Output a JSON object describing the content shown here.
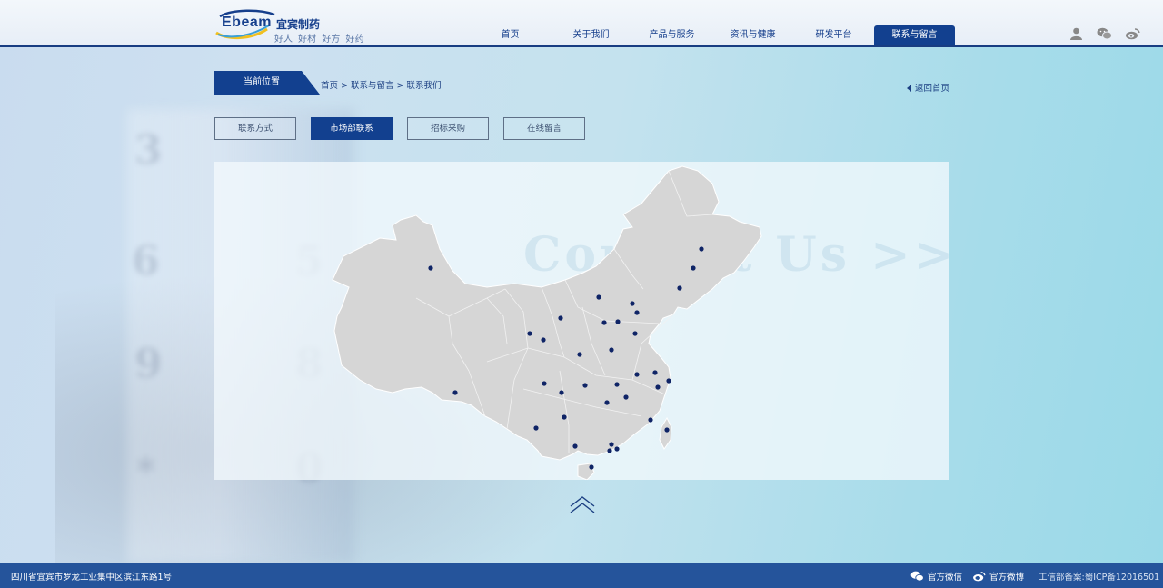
{
  "header": {
    "logo": {
      "en": "Ebeam",
      "cn": "宜宾制药",
      "slogan": "好人 好材 好方 好药"
    },
    "nav": [
      {
        "label": "首页"
      },
      {
        "label": "关于我们"
      },
      {
        "label": "产品与服务"
      },
      {
        "label": "资讯与健康"
      },
      {
        "label": "研发平台"
      },
      {
        "label": "联系与留言",
        "active": true
      }
    ],
    "icons": [
      "user-icon",
      "wechat-icon",
      "weibo-icon"
    ]
  },
  "location": {
    "label": "当前位置",
    "breadcrumb": [
      "首页",
      "联系与留言",
      "联系我们"
    ],
    "separator": ">",
    "back_label": "返回首页"
  },
  "subtabs": [
    {
      "label": "联系方式"
    },
    {
      "label": "市场部联系",
      "active": true
    },
    {
      "label": "招标采购"
    },
    {
      "label": "在线留言"
    }
  ],
  "background": {
    "watermark": "Contact Us >>"
  },
  "footer": {
    "address": "四川省宜宾市罗龙工业集中区滨江东路1号",
    "wechat_label": "官方微信",
    "weibo_label": "官方微博",
    "icp": "工信部备案:蜀ICP备12016501"
  },
  "colors": {
    "primary": "#12408f",
    "footer": "#25549b",
    "map_fill": "#d6d6d6",
    "map_dot": "#0f2466"
  }
}
